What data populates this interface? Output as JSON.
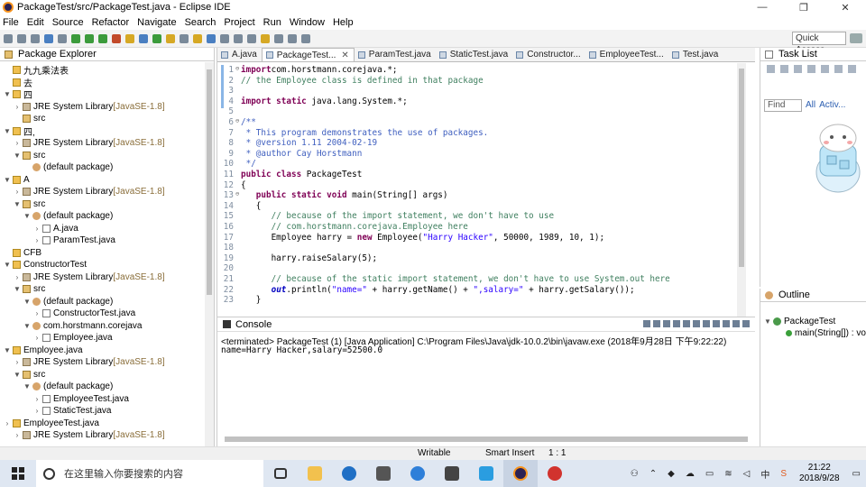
{
  "window": {
    "title": "PackageTest/src/PackageTest.java - Eclipse IDE",
    "minimize": "—",
    "maximize": "❐",
    "close": "✕"
  },
  "menu": [
    "File",
    "Edit",
    "Source",
    "Refactor",
    "Navigate",
    "Search",
    "Project",
    "Run",
    "Window",
    "Help"
  ],
  "toolbar": {
    "quick_access": "Quick Access"
  },
  "package_explorer": {
    "title": "Package Explorer",
    "rows": [
      {
        "text": "九九乘法表",
        "icon": "project-icon",
        "indent": 0,
        "twisty": "",
        "hint": ""
      },
      {
        "text": "去",
        "icon": "project-icon",
        "indent": 0,
        "twisty": "",
        "hint": ""
      },
      {
        "text": "四",
        "icon": "project-icon",
        "indent": 0,
        "twisty": "▼",
        "hint": ""
      },
      {
        "text": "JRE System Library",
        "icon": "library-icon",
        "indent": 1,
        "twisty": "›",
        "hint": " [JavaSE-1.8]"
      },
      {
        "text": "src",
        "icon": "source-folder-icon",
        "indent": 1,
        "twisty": "",
        "hint": ""
      },
      {
        "text": "四,",
        "icon": "project-icon",
        "indent": 0,
        "twisty": "▼",
        "hint": ""
      },
      {
        "text": "JRE System Library",
        "icon": "library-icon",
        "indent": 1,
        "twisty": "›",
        "hint": " [JavaSE-1.8]"
      },
      {
        "text": "src",
        "icon": "source-folder-icon",
        "indent": 1,
        "twisty": "▼",
        "hint": ""
      },
      {
        "text": "(default package)",
        "icon": "package-icon",
        "indent": 2,
        "twisty": "",
        "hint": ""
      },
      {
        "text": "A",
        "icon": "project-icon",
        "indent": 0,
        "twisty": "▼",
        "hint": ""
      },
      {
        "text": "JRE System Library",
        "icon": "library-icon",
        "indent": 1,
        "twisty": "›",
        "hint": " [JavaSE-1.8]"
      },
      {
        "text": "src",
        "icon": "source-folder-icon",
        "indent": 1,
        "twisty": "▼",
        "hint": ""
      },
      {
        "text": "(default package)",
        "icon": "package-icon",
        "indent": 2,
        "twisty": "▼",
        "hint": ""
      },
      {
        "text": "A.java",
        "icon": "java-file-icon",
        "indent": 3,
        "twisty": "›",
        "hint": ""
      },
      {
        "text": "ParamTest.java",
        "icon": "java-file-icon",
        "indent": 3,
        "twisty": "›",
        "hint": ""
      },
      {
        "text": "CFB",
        "icon": "project-icon",
        "indent": 0,
        "twisty": "",
        "hint": ""
      },
      {
        "text": "ConstructorTest",
        "icon": "project-icon",
        "indent": 0,
        "twisty": "▼",
        "hint": ""
      },
      {
        "text": "JRE System Library",
        "icon": "library-icon",
        "indent": 1,
        "twisty": "›",
        "hint": " [JavaSE-1.8]"
      },
      {
        "text": "src",
        "icon": "source-folder-icon",
        "indent": 1,
        "twisty": "▼",
        "hint": ""
      },
      {
        "text": "(default package)",
        "icon": "package-icon",
        "indent": 2,
        "twisty": "▼",
        "hint": ""
      },
      {
        "text": "ConstructorTest.java",
        "icon": "java-file-icon",
        "indent": 3,
        "twisty": "›",
        "hint": ""
      },
      {
        "text": "com.horstmann.corejava",
        "icon": "package-icon",
        "indent": 2,
        "twisty": "▼",
        "hint": ""
      },
      {
        "text": "Employee.java",
        "icon": "java-file-icon",
        "indent": 3,
        "twisty": "›",
        "hint": ""
      },
      {
        "text": "Employee.java",
        "icon": "project-icon",
        "indent": 0,
        "twisty": "▼",
        "hint": ""
      },
      {
        "text": "JRE System Library",
        "icon": "library-icon",
        "indent": 1,
        "twisty": "›",
        "hint": " [JavaSE-1.8]"
      },
      {
        "text": "src",
        "icon": "source-folder-icon",
        "indent": 1,
        "twisty": "▼",
        "hint": ""
      },
      {
        "text": "(default package)",
        "icon": "package-icon",
        "indent": 2,
        "twisty": "▼",
        "hint": ""
      },
      {
        "text": "EmployeeTest.java",
        "icon": "java-file-icon",
        "indent": 3,
        "twisty": "›",
        "hint": ""
      },
      {
        "text": "StaticTest.java",
        "icon": "java-file-icon",
        "indent": 3,
        "twisty": "›",
        "hint": ""
      },
      {
        "text": "EmployeeTest.java",
        "icon": "project-icon",
        "indent": 0,
        "twisty": "›",
        "hint": ""
      },
      {
        "text": "JRE System Library",
        "icon": "library-icon",
        "indent": 1,
        "twisty": "›",
        "hint": " [JavaSE-1.8]"
      }
    ]
  },
  "editor": {
    "tabs": [
      {
        "label": "A.java",
        "active": false
      },
      {
        "label": "PackageTest...",
        "active": true
      },
      {
        "label": "ParamTest.java",
        "active": false
      },
      {
        "label": "StaticTest.java",
        "active": false
      },
      {
        "label": "Constructor...",
        "active": false
      },
      {
        "label": "EmployeeTest...",
        "active": false
      },
      {
        "label": "Test.java",
        "active": false
      }
    ],
    "lines": [
      {
        "n": "1",
        "fold": "⊖",
        "segs": [
          [
            "kw",
            "import"
          ],
          [
            "",
            "com.horstmann.corejava.*;"
          ]
        ]
      },
      {
        "n": "2",
        "fold": "",
        "segs": [
          [
            "cm",
            "// the Employee class is defined in that package"
          ]
        ]
      },
      {
        "n": "3",
        "fold": "",
        "segs": []
      },
      {
        "n": "4",
        "fold": "",
        "segs": [
          [
            "kw",
            "import static"
          ],
          [
            "",
            " java.lang.System.*;"
          ]
        ]
      },
      {
        "n": "5",
        "fold": "",
        "segs": []
      },
      {
        "n": "6",
        "fold": "⊖",
        "segs": [
          [
            "jd",
            "/**"
          ]
        ]
      },
      {
        "n": "7",
        "fold": "",
        "segs": [
          [
            "jd",
            " * This program demonstrates the use of packages."
          ]
        ]
      },
      {
        "n": "8",
        "fold": "",
        "segs": [
          [
            "jd",
            " * @version 1.11 2004-02-19"
          ]
        ]
      },
      {
        "n": "9",
        "fold": "",
        "segs": [
          [
            "jd",
            " * @author Cay Horstmann"
          ]
        ]
      },
      {
        "n": "10",
        "fold": "",
        "segs": [
          [
            "jd",
            " */"
          ]
        ]
      },
      {
        "n": "11",
        "fold": "",
        "segs": [
          [
            "kw",
            "public class"
          ],
          [
            "",
            " PackageTest"
          ]
        ]
      },
      {
        "n": "12",
        "fold": "",
        "segs": [
          [
            "",
            "{"
          ]
        ]
      },
      {
        "n": "13",
        "fold": "⊖",
        "segs": [
          [
            "",
            "   "
          ],
          [
            "kw",
            "public static void"
          ],
          [
            "",
            " main(String[] args)"
          ]
        ]
      },
      {
        "n": "14",
        "fold": "",
        "segs": [
          [
            "",
            "   {"
          ]
        ]
      },
      {
        "n": "15",
        "fold": "",
        "segs": [
          [
            "",
            "      "
          ],
          [
            "cm",
            "// because of the import statement, we don't have to use"
          ]
        ]
      },
      {
        "n": "16",
        "fold": "",
        "segs": [
          [
            "",
            "      "
          ],
          [
            "cm",
            "// com.horstmann.corejava.Employee here"
          ]
        ]
      },
      {
        "n": "17",
        "fold": "",
        "segs": [
          [
            "",
            "      Employee harry = "
          ],
          [
            "kw",
            "new"
          ],
          [
            "",
            " Employee("
          ],
          [
            "st",
            "\"Harry Hacker\""
          ],
          [
            "",
            ", 50000, 1989, 10, 1);"
          ]
        ]
      },
      {
        "n": "18",
        "fold": "",
        "segs": []
      },
      {
        "n": "19",
        "fold": "",
        "segs": [
          [
            "",
            "      harry.raiseSalary(5);"
          ]
        ]
      },
      {
        "n": "20",
        "fold": "",
        "segs": []
      },
      {
        "n": "21",
        "fold": "",
        "segs": [
          [
            "",
            "      "
          ],
          [
            "cm",
            "// because of the static import statement, we don't have to use System.out here"
          ]
        ]
      },
      {
        "n": "22",
        "fold": "",
        "segs": [
          [
            "",
            "      "
          ],
          [
            "fi",
            "out"
          ],
          [
            "",
            ".println("
          ],
          [
            "st",
            "\"name=\""
          ],
          [
            "",
            " + harry.getName() + "
          ],
          [
            "st",
            "\",salary=\""
          ],
          [
            "",
            " + harry.getSalary());"
          ]
        ]
      },
      {
        "n": "23",
        "fold": "",
        "segs": [
          [
            "",
            "   }"
          ]
        ]
      }
    ]
  },
  "task_list": {
    "title": "Task List",
    "find_placeholder": "Find",
    "all": "All",
    "activate": "Activ..."
  },
  "outline": {
    "title": "Outline",
    "class_name": "PackageTest",
    "method": "main(String[]) : vo"
  },
  "console": {
    "title": "Console",
    "header": "<terminated> PackageTest (1) [Java Application] C:\\Program Files\\Java\\jdk-10.0.2\\bin\\javaw.exe (2018年9月28日 下午9:22:22)",
    "output": "name=Harry Hacker,salary=52500.0"
  },
  "status": {
    "writable": "Writable",
    "insert_mode": "Smart Insert",
    "position": "1 : 1"
  },
  "taskbar": {
    "search_placeholder": "在这里输入你要搜索的内容",
    "ime": "中",
    "time": "21:22",
    "date": "2018/9/28"
  }
}
